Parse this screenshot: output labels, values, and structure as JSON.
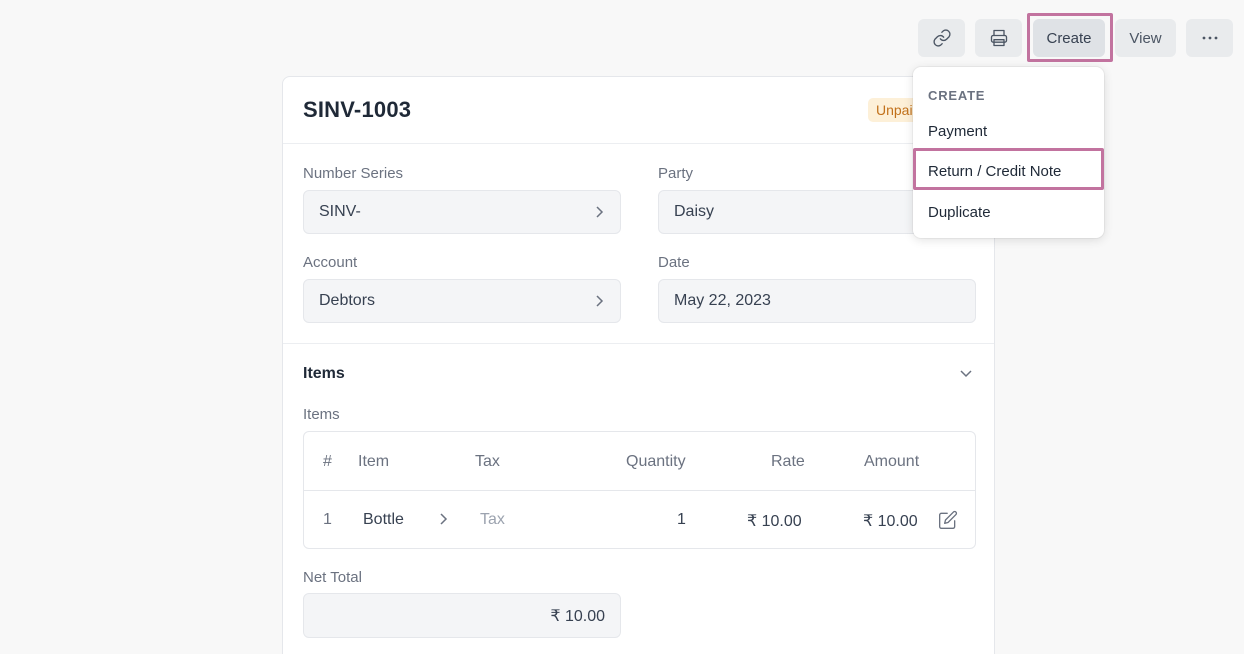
{
  "toolbar": {
    "link_icon": "link-icon",
    "print_icon": "printer-icon",
    "create_label": "Create",
    "view_label": "View",
    "more_icon": "more-horizontal-icon"
  },
  "dropdown": {
    "heading": "CREATE",
    "items": [
      "Payment",
      "Return / Credit Note",
      "Duplicate"
    ]
  },
  "document": {
    "title": "SINV-1003",
    "status": "Unpaid"
  },
  "fields": {
    "number_series": {
      "label": "Number Series",
      "value": "SINV-"
    },
    "party": {
      "label": "Party",
      "value": "Daisy"
    },
    "account": {
      "label": "Account",
      "value": "Debtors"
    },
    "date": {
      "label": "Date",
      "value": "May 22, 2023"
    }
  },
  "items_section": {
    "title": "Items",
    "table_label": "Items",
    "columns": [
      "#",
      "Item",
      "Tax",
      "Quantity",
      "Rate",
      "Amount"
    ],
    "rows": [
      {
        "index": "1",
        "item": "Bottle",
        "tax": "Tax",
        "quantity": "1",
        "rate": "₹ 10.00",
        "amount": "₹ 10.00"
      }
    ]
  },
  "net_total": {
    "label": "Net Total",
    "value": "₹ 10.00"
  },
  "colors": {
    "highlight": "#c2739f",
    "badge_bg": "#fdf0d8",
    "badge_text": "#c2711b"
  }
}
